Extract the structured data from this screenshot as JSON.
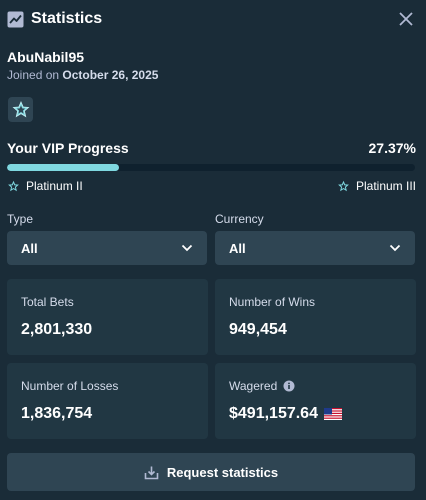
{
  "header": {
    "title": "Statistics",
    "title_icon": "chart-trend-icon",
    "close_icon": "close-icon"
  },
  "user": {
    "username": "AbuNabil95",
    "joined_prefix": "Joined on",
    "joined_date": "October 26, 2025"
  },
  "vip": {
    "title": "Your VIP Progress",
    "percent_label": "27.37%",
    "progress_fraction": 0.2737,
    "current_tier": "Platinum II",
    "next_tier": "Platinum III",
    "accent_color": "#7fd8e0"
  },
  "filters": {
    "type_label": "Type",
    "type_value": "All",
    "currency_label": "Currency",
    "currency_value": "All"
  },
  "stats": {
    "total_bets_label": "Total Bets",
    "total_bets_value": "2,801,330",
    "wins_label": "Number of Wins",
    "wins_value": "949,454",
    "losses_label": "Number of Losses",
    "losses_value": "1,836,754",
    "wagered_label": "Wagered",
    "wagered_value": "$491,157.64"
  },
  "action": {
    "request_label": "Request statistics"
  },
  "colors": {
    "background": "#1a2c38",
    "card": "#213743",
    "control": "#2f4553",
    "track": "#0f212e"
  }
}
